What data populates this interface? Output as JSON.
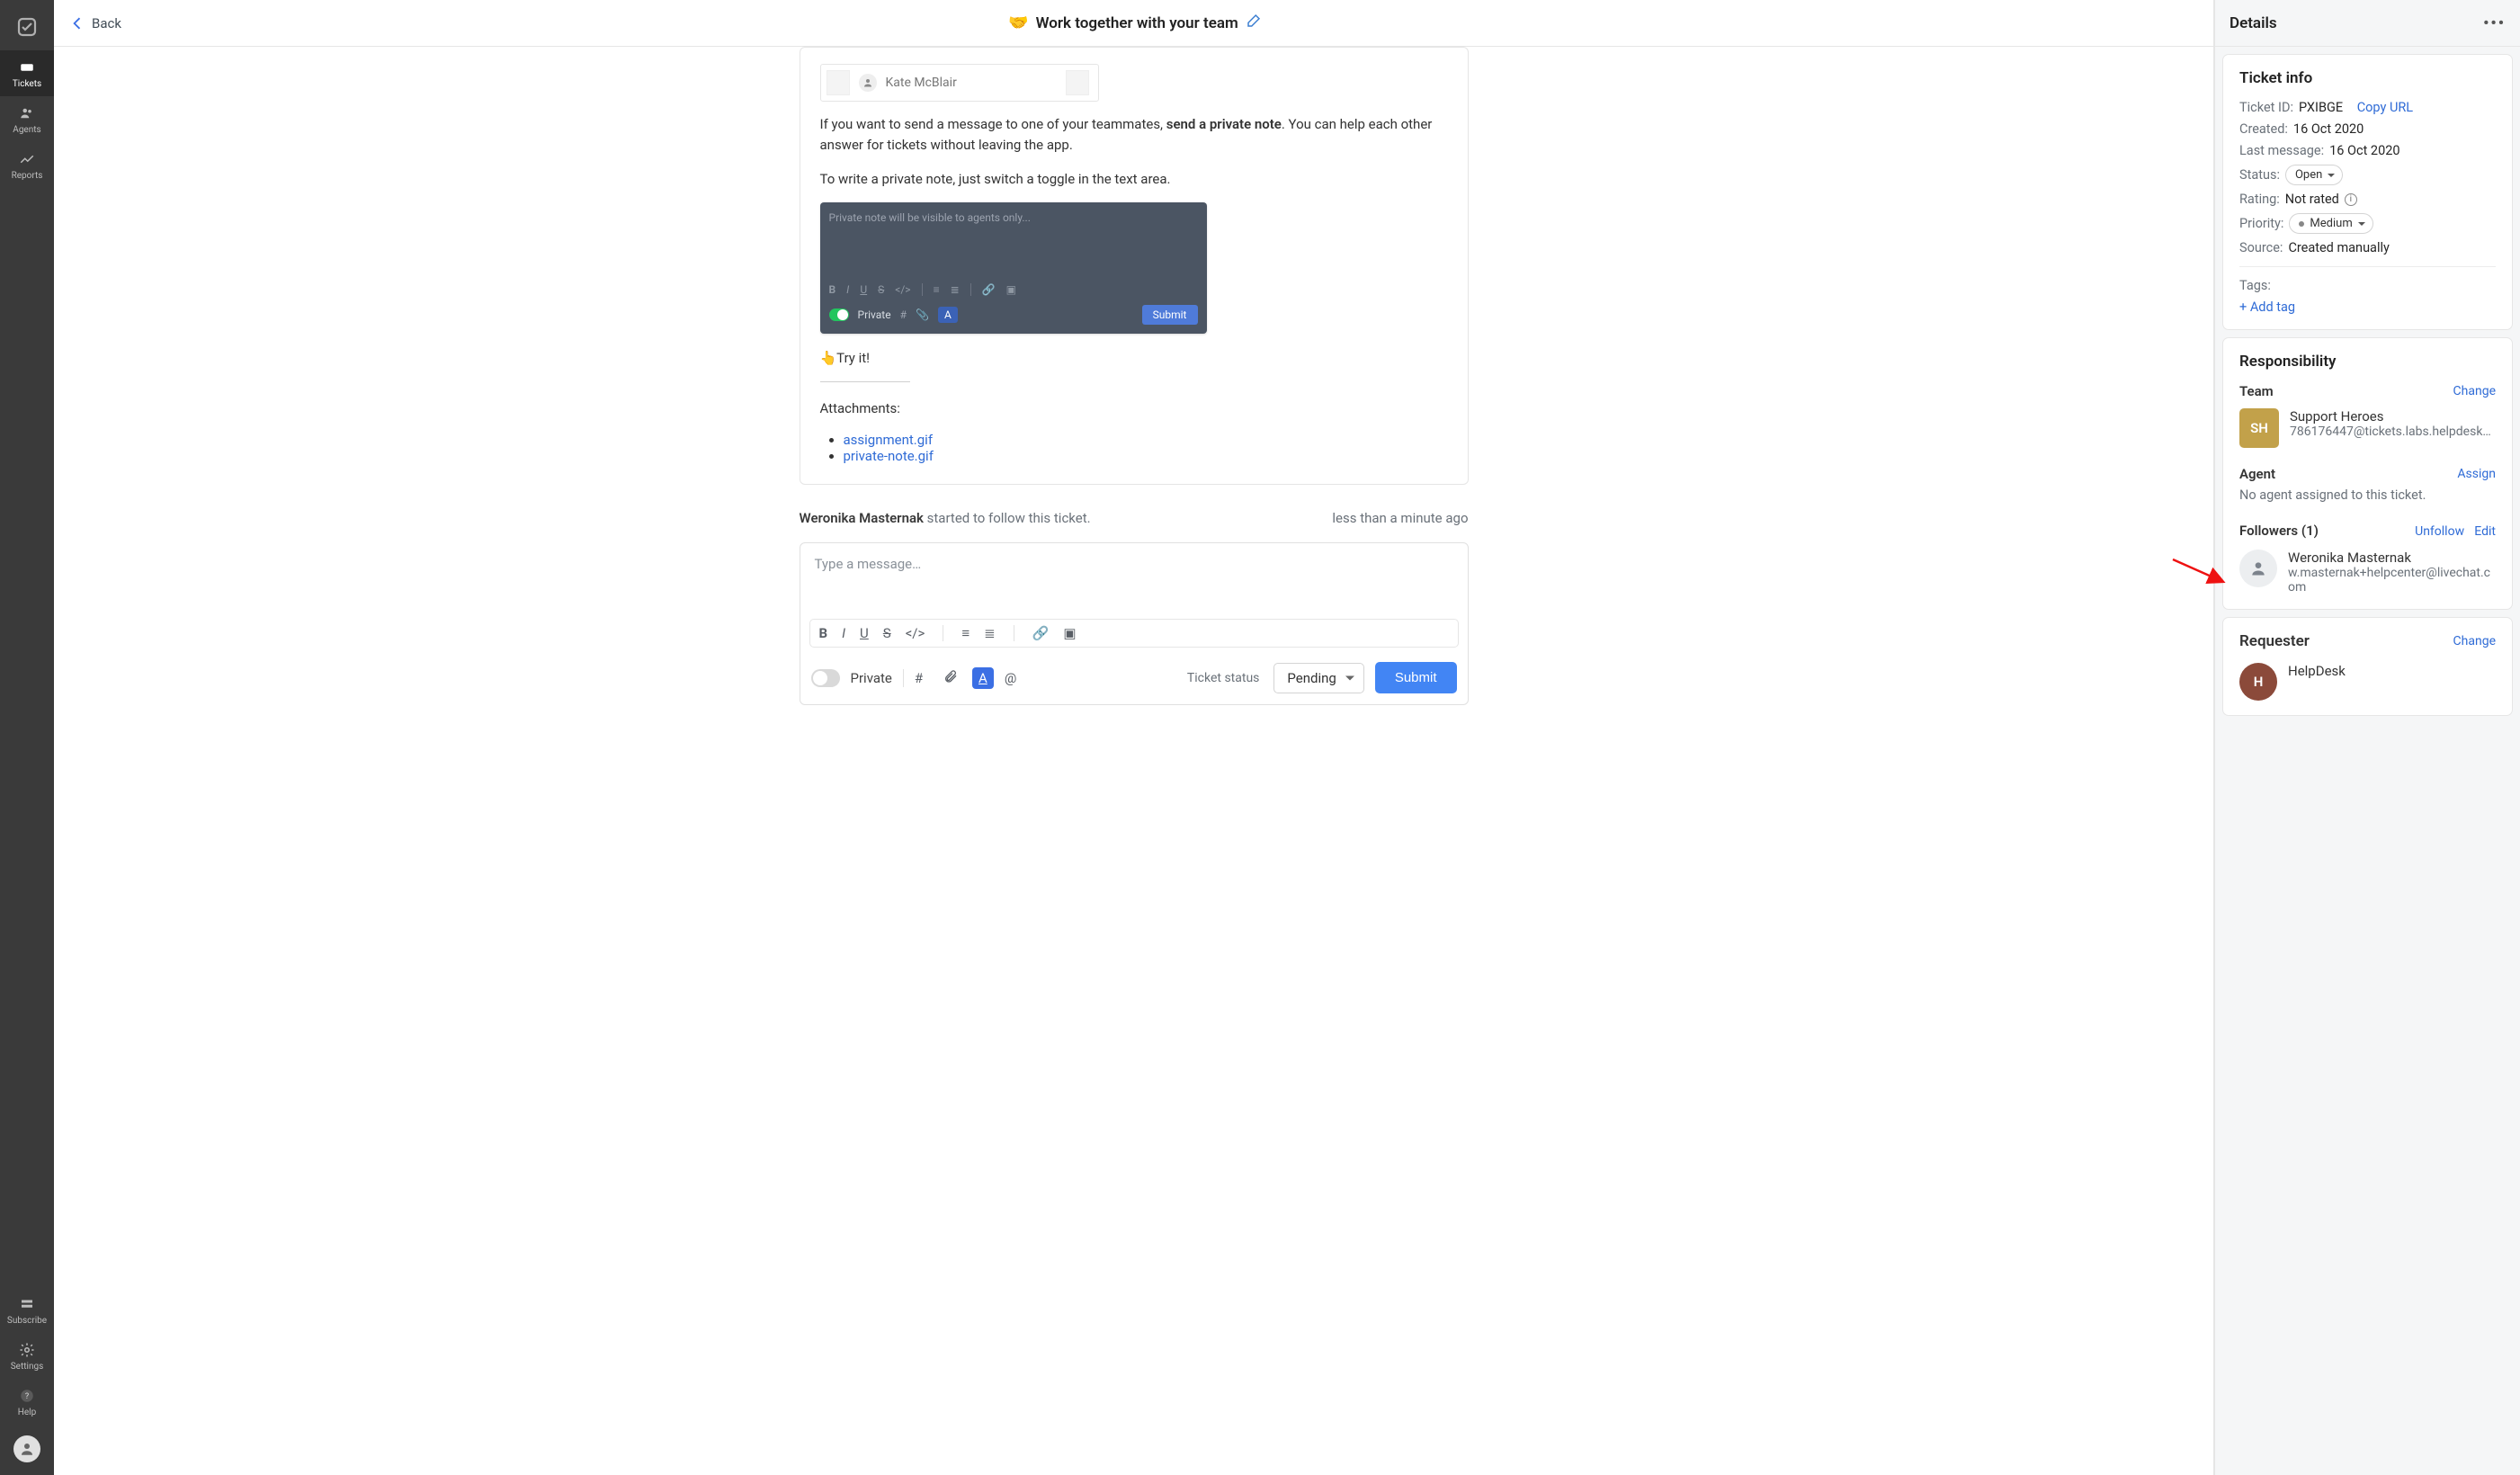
{
  "rail": {
    "items": [
      {
        "label": "Tickets"
      },
      {
        "label": "Agents"
      },
      {
        "label": "Reports"
      }
    ],
    "subscribe": "Subscribe",
    "settings": "Settings",
    "help": "Help"
  },
  "topbar": {
    "back": "Back",
    "title_emoji": "🤝",
    "title": "Work together with your team"
  },
  "message": {
    "search_name": "Kate McBlair",
    "p1_pre": "If you want to send a message to one of your teammates, ",
    "p1_strong": "send a private note",
    "p1_post": ". You can help each other answer for tickets without leaving the app.",
    "p2": "To write a private note, just switch a toggle in the text area.",
    "shot_placeholder": "Private note will be visible to agents only...",
    "shot_private": "Private",
    "shot_submit": "Submit",
    "tryit": "👆Try it!",
    "attach_label": "Attachments:",
    "attachments": [
      "assignment.gif",
      "private-note.gif"
    ]
  },
  "activity": {
    "actor": "Weronika Masternak",
    "text": " started to follow this ticket.",
    "time": "less than a minute ago"
  },
  "composer": {
    "placeholder": "Type a message…",
    "private": "Private",
    "status_label": "Ticket status",
    "status_value": "Pending",
    "submit": "Submit"
  },
  "details": {
    "header": "Details",
    "ticket_info": {
      "title": "Ticket info",
      "id_label": "Ticket ID:",
      "id_value": "PXIBGE",
      "copy": "Copy URL",
      "created_label": "Created:",
      "created_value": "16 Oct 2020",
      "last_label": "Last message:",
      "last_value": "16 Oct 2020",
      "status_label": "Status:",
      "status_value": "Open",
      "rating_label": "Rating:",
      "rating_value": "Not rated",
      "priority_label": "Priority:",
      "priority_value": "Medium",
      "source_label": "Source:",
      "source_value": "Created manually",
      "tags_label": "Tags:",
      "add_tag": "+ Add tag"
    },
    "responsibility": {
      "title": "Responsibility",
      "team_label": "Team",
      "team_change": "Change",
      "team_initials": "SH",
      "team_name": "Support Heroes",
      "team_email": "786176447@tickets.labs.helpdesk…",
      "agent_label": "Agent",
      "agent_assign": "Assign",
      "no_agent": "No agent assigned to this ticket.",
      "followers_label": "Followers (1)",
      "unfollow": "Unfollow",
      "edit": "Edit",
      "follower_name": "Weronika Masternak",
      "follower_email": "w.masternak+helpcenter@livechat.com"
    },
    "requester": {
      "title": "Requester",
      "change": "Change",
      "initial": "H",
      "name": "HelpDesk"
    }
  }
}
